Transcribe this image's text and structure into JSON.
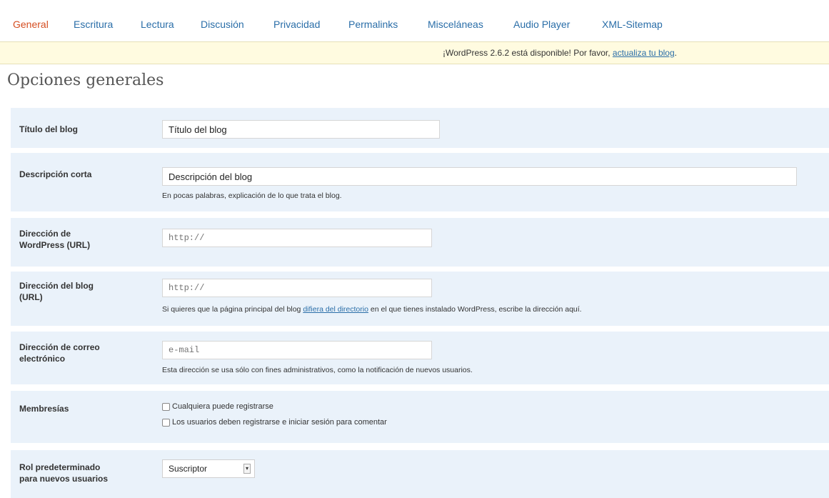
{
  "nav": {
    "tabs": [
      {
        "label": "General"
      },
      {
        "label": "Escritura"
      },
      {
        "label": "Lectura"
      },
      {
        "label": "Discusión"
      },
      {
        "label": "Privacidad"
      },
      {
        "label": "Permalinks"
      },
      {
        "label": "Misceláneas"
      },
      {
        "label": "Audio Player"
      },
      {
        "label": "XML-Sitemap"
      }
    ]
  },
  "notice": {
    "text": "¡WordPress 2.6.2 está disponible! Por favor, ",
    "link": "actualiza tu blog",
    "suffix": "."
  },
  "page": {
    "title": "Opciones generales"
  },
  "fields": {
    "blog_title": {
      "label": "Título del blog",
      "value": "Título del blog"
    },
    "tagline": {
      "label": "Descripción corta",
      "value": "Descripción del blog",
      "desc": "En pocas palabras, explicación de lo que trata el blog."
    },
    "wp_url": {
      "label_1": "Dirección de",
      "label_2": "WordPress (URL)",
      "value": "http://"
    },
    "blog_url": {
      "label_1": "Dirección del blog",
      "label_2": "(URL)",
      "value": "http://",
      "desc_pre": "Si quieres que la página principal del blog ",
      "desc_link": "difiera del directorio",
      "desc_post": " en el que tienes instalado WordPress, escribe la dirección aquí."
    },
    "email": {
      "label_1": "Dirección de correo",
      "label_2": "electrónico",
      "value": "e-mail",
      "desc": "Esta dirección se usa sólo con fines administrativos, como la notificación de nuevos usuarios."
    },
    "membership": {
      "label": "Membresías",
      "option_1": "Cualquiera puede registrarse",
      "option_2": "Los usuarios deben registrarse e iniciar sesión para comentar"
    },
    "default_role": {
      "label_1": "Rol predeterminado",
      "label_2": "para nuevos usuarios",
      "selected": "Suscriptor"
    }
  }
}
